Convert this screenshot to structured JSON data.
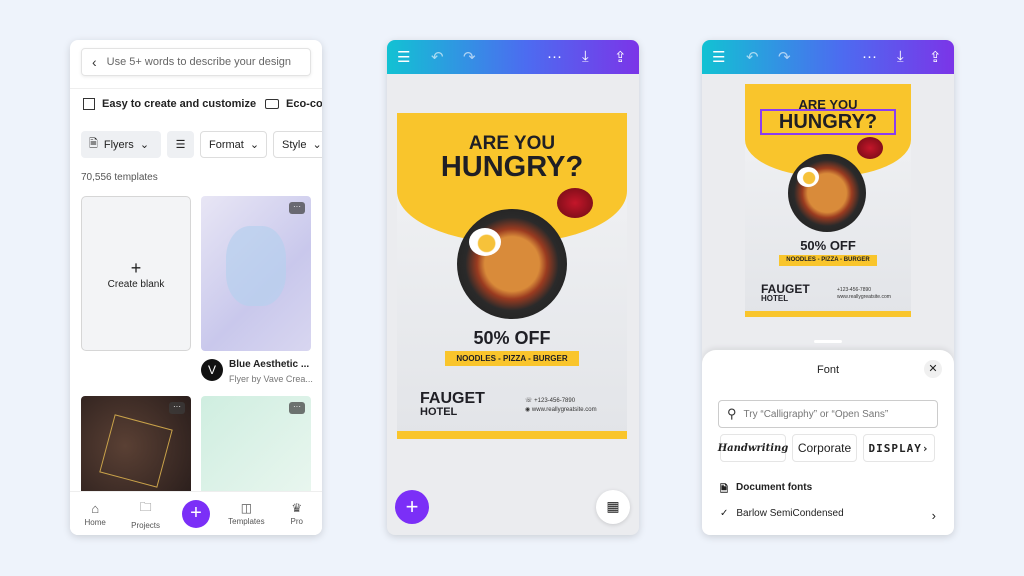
{
  "panel1": {
    "search_placeholder": "Use 5+ words to describe your design",
    "features": [
      "Easy to create and customize",
      "Eco-co"
    ],
    "filters": {
      "flyers": "Flyers",
      "format": "Format",
      "style": "Style"
    },
    "template_count": "70,556 templates",
    "create_blank": "Create blank",
    "templates": [
      {
        "title": "Blue Aesthetic ...",
        "subtitle": "Flyer by Vave Crea..."
      }
    ],
    "nav": [
      "Home",
      "Projects",
      "Templates",
      "Pro"
    ]
  },
  "flyer": {
    "line1": "ARE YOU",
    "line2": "HUNGRY?",
    "offer": "50% OFF",
    "tagline": "NOODLES - PIZZA - BURGER",
    "brand": "FAUGET",
    "brand_sub": "HOTEL",
    "phone": "+123-456-7890",
    "website": "www.reallygreatsite.com"
  },
  "font_sheet": {
    "title": "Font",
    "search_placeholder": "Try “Calligraphy” or “Open Sans”",
    "categories": [
      "Handwriting",
      "Corporate",
      "DISPLAY"
    ],
    "document_fonts": "Document fonts",
    "current_font": "Barlow SemiCondensed"
  },
  "colors": {
    "accent": "#7b2ff7",
    "yellow": "#f9c52c",
    "header_start": "#12c2d3",
    "header_end": "#7b35e8"
  }
}
